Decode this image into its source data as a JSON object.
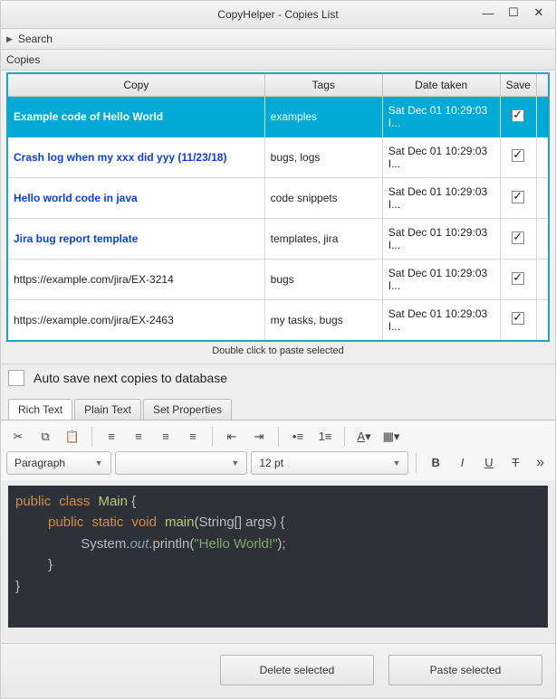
{
  "window": {
    "title": "CopyHelper - Copies List"
  },
  "search": {
    "label": "Search"
  },
  "section": {
    "label": "Copies"
  },
  "table": {
    "headers": {
      "copy": "Copy",
      "tags": "Tags",
      "date": "Date taken",
      "save": "Save"
    },
    "rows": [
      {
        "copy": "Example code of Hello World",
        "tags": "examples",
        "date": "Sat Dec 01 10:29:03 I...",
        "saved": true,
        "selected": true,
        "link": false
      },
      {
        "copy": "Crash log when my xxx did yyy (11/23/18)",
        "tags": "bugs, logs",
        "date": "Sat Dec 01 10:29:03 I...",
        "saved": true,
        "selected": false,
        "link": false
      },
      {
        "copy": "Hello world code in java",
        "tags": "code snippets",
        "date": "Sat Dec 01 10:29:03 I...",
        "saved": true,
        "selected": false,
        "link": false
      },
      {
        "copy": "Jira bug report template",
        "tags": "templates, jira",
        "date": "Sat Dec 01 10:29:03 I...",
        "saved": true,
        "selected": false,
        "link": false
      },
      {
        "copy": "https://example.com/jira/EX-3214",
        "tags": "bugs",
        "date": "Sat Dec 01 10:29:03 I...",
        "saved": true,
        "selected": false,
        "link": true
      },
      {
        "copy": "https://example.com/jira/EX-2463",
        "tags": "my tasks, bugs",
        "date": "Sat Dec 01 10:29:03 I...",
        "saved": true,
        "selected": false,
        "link": true
      }
    ]
  },
  "hint": "Double click to paste selected",
  "autosave": {
    "label": "Auto save next copies to database"
  },
  "tabs": {
    "rich": "Rich Text",
    "plain": "Plain Text",
    "props": "Set Properties"
  },
  "toolbar2": {
    "para": "Paragraph",
    "size": "12 pt"
  },
  "code": {
    "line1_kw1": "public",
    "line1_kw2": "class",
    "line1_cls": "Main",
    "line1_brace": " {",
    "line2_kw1": "public",
    "line2_kw2": "static",
    "line2_kw3": "void",
    "line2_fn": "main",
    "line2_args": "(String[] args) {",
    "line3_pre": "System.",
    "line3_it": "out",
    "line3_mid": ".println(",
    "line3_str": "\"Hello World!\"",
    "line3_end": ");",
    "line4": "}",
    "line5": "}"
  },
  "buttons": {
    "delete": "Delete selected",
    "paste": "Paste selected"
  }
}
